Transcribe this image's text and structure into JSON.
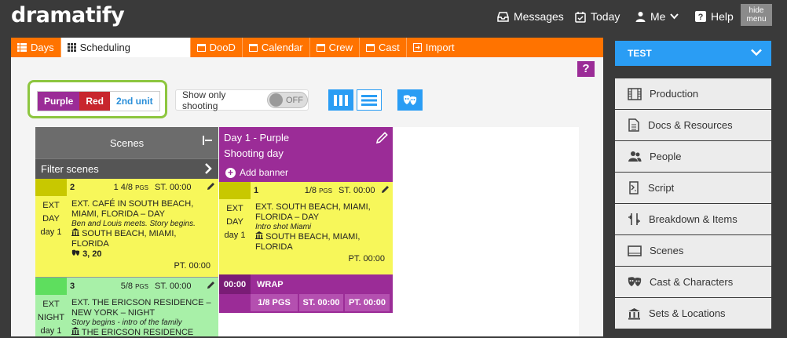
{
  "app": {
    "logo": "dramatify"
  },
  "topnav": {
    "messages": "Messages",
    "today": "Today",
    "me": "Me",
    "help": "Help",
    "hide_menu_line1": "hide",
    "hide_menu_line2": "menu"
  },
  "tabs": [
    {
      "label": "Days",
      "icon": "list-icon",
      "active": false
    },
    {
      "label": "Scheduling",
      "icon": "grid-icon",
      "active": true
    },
    {
      "label": "DooD",
      "icon": "calendar-icon",
      "active": false
    },
    {
      "label": "Calendar",
      "icon": "calendar-icon",
      "active": false
    },
    {
      "label": "Crew",
      "icon": "calendar-icon",
      "active": false
    },
    {
      "label": "Cast",
      "icon": "calendar-icon",
      "active": false
    },
    {
      "label": "Import",
      "icon": "import-icon",
      "active": false
    }
  ],
  "help_button": "?",
  "units": {
    "purple": "Purple",
    "red": "Red",
    "second": "2nd unit"
  },
  "filters": {
    "show_only_shooting": "Show only shooting",
    "toggle_state": "OFF"
  },
  "scenes_panel": {
    "title": "Scenes",
    "filter": "Filter scenes"
  },
  "strips": [
    {
      "number": "2",
      "pages": "1 4/8",
      "pgs": "PGS",
      "st": "ST. 00:00",
      "ext": "EXT",
      "time": "DAY",
      "day": "day 1",
      "heading": "EXT. CAFÉ IN SOUTH BEACH, MIAMI, FLORIDA – DAY",
      "synopsis": "Ben and Louis meets. Story begins.",
      "location": "SOUTH BEACH, MIAMI, FLORIDA",
      "cast": "3, 20",
      "pt": "PT. 00:00",
      "color": "#f7f75a",
      "swatch": "#c8c800"
    },
    {
      "number": "3",
      "pages": "5/8",
      "pgs": "PGS",
      "st": "ST. 00:00",
      "ext": "EXT",
      "time": "NIGHT",
      "day": "day 1",
      "heading": "EXT. THE ERICSON RESIDENCE – NEW YORK – NIGHT",
      "synopsis": "Story begins - intro of the family",
      "location": "THE ERICSON RESIDENCE",
      "color": "#a8f0a8",
      "swatch": "#5ede5e"
    }
  ],
  "day": {
    "title": "Day 1 - Purple",
    "subtitle": "Shooting day",
    "add_banner": "Add banner",
    "strip": {
      "number": "1",
      "pages": "1/8",
      "pgs": "PGS",
      "st": "ST. 00:00",
      "ext": "EXT",
      "time": "DAY",
      "day": "day 1",
      "heading": "EXT. SOUTH BEACH, MIAMI, FLORIDA – DAY",
      "synopsis": "Intro shot Miami",
      "location": "SOUTH BEACH, MIAMI, FLORIDA",
      "pt": "PT. 00:00"
    },
    "wrap": {
      "time": "00:00",
      "label": "WRAP",
      "pgs": "1/8 PGS",
      "st": "ST. 00:00",
      "pt": "PT. 00:00"
    }
  },
  "sidebar": {
    "project": "TEST",
    "items": [
      {
        "label": "Production",
        "icon": "film-icon"
      },
      {
        "label": "Docs & Resources",
        "icon": "document-icon"
      },
      {
        "label": "People",
        "icon": "people-icon"
      },
      {
        "label": "Script",
        "icon": "script-icon"
      },
      {
        "label": "Breakdown & Items",
        "icon": "breakdown-icon"
      },
      {
        "label": "Scenes",
        "icon": "scenes-icon"
      },
      {
        "label": "Cast & Characters",
        "icon": "masks-icon"
      },
      {
        "label": "Sets & Locations",
        "icon": "location-icon"
      }
    ]
  },
  "colors": {
    "orange": "#ff7300",
    "purple": "#9b2c97",
    "red": "#c8262d",
    "blue": "#2a9df4",
    "green": "#8dc63f"
  }
}
